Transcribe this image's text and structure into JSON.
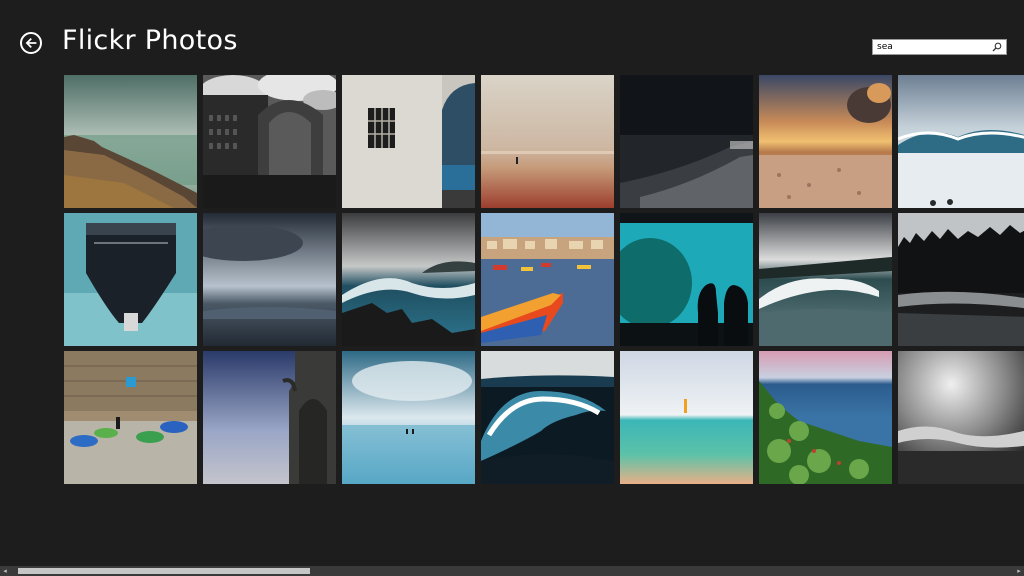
{
  "header": {
    "title": "Flickr Photos",
    "back_icon": "back-arrow-circle-icon"
  },
  "search": {
    "value": "sea",
    "icon": "search-icon"
  },
  "scrollbar": {
    "left_arrow": "◂",
    "right_arrow": "▸"
  },
  "colors": {
    "background": "#1d1d1d",
    "title_text": "#ffffff",
    "scroll_track": "#3a3a3a",
    "scroll_thumb": "#c6c6c6"
  }
}
